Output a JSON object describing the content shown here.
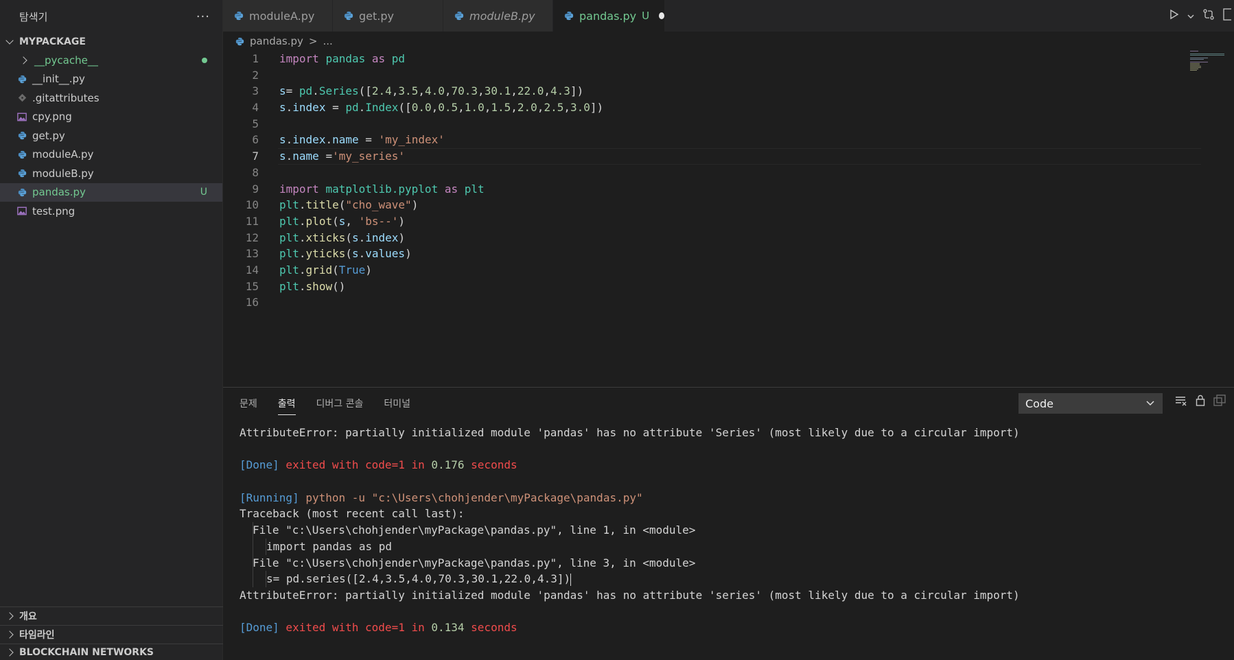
{
  "colors": {
    "keyword": "#c586c0",
    "module": "#4ec9b0",
    "function": "#dcdcaa",
    "variable": "#9cdcfe",
    "number": "#b5cea8",
    "string": "#ce9178",
    "boolean": "#569cd6",
    "text": "#d4d4d4",
    "git_untracked": "#73c991"
  },
  "sidebar": {
    "title": "탐색기",
    "more": "···",
    "section": "MYPACKAGE",
    "items": [
      {
        "label": "__pycache__",
        "type": "folder",
        "icon": "chevron-right-icon"
      },
      {
        "label": "__init__.py",
        "type": "python",
        "icon": "python-icon"
      },
      {
        "label": ".gitattributes",
        "type": "git",
        "icon": "git-icon"
      },
      {
        "label": "cpy.png",
        "type": "image",
        "icon": "image-icon"
      },
      {
        "label": "get.py",
        "type": "python",
        "icon": "python-icon"
      },
      {
        "label": "moduleA.py",
        "type": "python",
        "icon": "python-icon"
      },
      {
        "label": "moduleB.py",
        "type": "python",
        "icon": "python-icon"
      },
      {
        "label": "pandas.py",
        "type": "python",
        "icon": "python-icon",
        "badge": "U"
      },
      {
        "label": "test.png",
        "type": "image",
        "icon": "image-icon"
      }
    ],
    "bottom_sections": [
      "개요",
      "타임라인",
      "BLOCKCHAIN NETWORKS"
    ]
  },
  "tabs": [
    {
      "label": "moduleA.py"
    },
    {
      "label": "get.py"
    },
    {
      "label": "moduleB.py"
    },
    {
      "label": "pandas.py",
      "badge": "U"
    }
  ],
  "breadcrumb": {
    "file": "pandas.py",
    "sep": ">",
    "rest": "..."
  },
  "code": {
    "lines": [
      [
        {
          "t": "import",
          "c": "keyword"
        },
        {
          "t": " "
        },
        {
          "t": "pandas",
          "c": "module"
        },
        {
          "t": " "
        },
        {
          "t": "as",
          "c": "keyword"
        },
        {
          "t": " "
        },
        {
          "t": "pd",
          "c": "module"
        }
      ],
      [],
      [
        {
          "t": "s",
          "c": "variable"
        },
        {
          "t": "= "
        },
        {
          "t": "pd",
          "c": "module"
        },
        {
          "t": "."
        },
        {
          "t": "Series",
          "c": "module"
        },
        {
          "t": "(["
        },
        {
          "t": "2.4",
          "c": "number"
        },
        {
          "t": ","
        },
        {
          "t": "3.5",
          "c": "number"
        },
        {
          "t": ","
        },
        {
          "t": "4.0",
          "c": "number"
        },
        {
          "t": ","
        },
        {
          "t": "70.3",
          "c": "number"
        },
        {
          "t": ","
        },
        {
          "t": "30.1",
          "c": "number"
        },
        {
          "t": ","
        },
        {
          "t": "22.0",
          "c": "number"
        },
        {
          "t": ","
        },
        {
          "t": "4.3",
          "c": "number"
        },
        {
          "t": "])"
        }
      ],
      [
        {
          "t": "s",
          "c": "variable"
        },
        {
          "t": "."
        },
        {
          "t": "index",
          "c": "variable"
        },
        {
          "t": " = "
        },
        {
          "t": "pd",
          "c": "module"
        },
        {
          "t": "."
        },
        {
          "t": "Index",
          "c": "module"
        },
        {
          "t": "(["
        },
        {
          "t": "0.0",
          "c": "number"
        },
        {
          "t": ","
        },
        {
          "t": "0.5",
          "c": "number"
        },
        {
          "t": ","
        },
        {
          "t": "1.0",
          "c": "number"
        },
        {
          "t": ","
        },
        {
          "t": "1.5",
          "c": "number"
        },
        {
          "t": ","
        },
        {
          "t": "2.0",
          "c": "number"
        },
        {
          "t": ","
        },
        {
          "t": "2.5",
          "c": "number"
        },
        {
          "t": ","
        },
        {
          "t": "3.0",
          "c": "number"
        },
        {
          "t": "])"
        }
      ],
      [],
      [
        {
          "t": "s",
          "c": "variable"
        },
        {
          "t": "."
        },
        {
          "t": "index",
          "c": "variable"
        },
        {
          "t": "."
        },
        {
          "t": "name",
          "c": "variable"
        },
        {
          "t": " = "
        },
        {
          "t": "'my_index'",
          "c": "string"
        }
      ],
      [
        {
          "t": "s",
          "c": "variable"
        },
        {
          "t": "."
        },
        {
          "t": "name",
          "c": "variable"
        },
        {
          "t": " ="
        },
        {
          "t": "'my_series'",
          "c": "string"
        }
      ],
      [],
      [
        {
          "t": "import",
          "c": "keyword"
        },
        {
          "t": " "
        },
        {
          "t": "matplotlib.pyplot",
          "c": "module"
        },
        {
          "t": " "
        },
        {
          "t": "as",
          "c": "keyword"
        },
        {
          "t": " "
        },
        {
          "t": "plt",
          "c": "module"
        }
      ],
      [
        {
          "t": "plt",
          "c": "module"
        },
        {
          "t": "."
        },
        {
          "t": "title",
          "c": "function"
        },
        {
          "t": "("
        },
        {
          "t": "\"cho_wave\"",
          "c": "string"
        },
        {
          "t": ")"
        }
      ],
      [
        {
          "t": "plt",
          "c": "module"
        },
        {
          "t": "."
        },
        {
          "t": "plot",
          "c": "function"
        },
        {
          "t": "("
        },
        {
          "t": "s",
          "c": "variable"
        },
        {
          "t": ", "
        },
        {
          "t": "'bs--'",
          "c": "string"
        },
        {
          "t": ")"
        }
      ],
      [
        {
          "t": "plt",
          "c": "module"
        },
        {
          "t": "."
        },
        {
          "t": "xticks",
          "c": "function"
        },
        {
          "t": "("
        },
        {
          "t": "s",
          "c": "variable"
        },
        {
          "t": "."
        },
        {
          "t": "index",
          "c": "variable"
        },
        {
          "t": ")"
        }
      ],
      [
        {
          "t": "plt",
          "c": "module"
        },
        {
          "t": "."
        },
        {
          "t": "yticks",
          "c": "function"
        },
        {
          "t": "("
        },
        {
          "t": "s",
          "c": "variable"
        },
        {
          "t": "."
        },
        {
          "t": "values",
          "c": "variable"
        },
        {
          "t": ")"
        }
      ],
      [
        {
          "t": "plt",
          "c": "module"
        },
        {
          "t": "."
        },
        {
          "t": "grid",
          "c": "function"
        },
        {
          "t": "("
        },
        {
          "t": "True",
          "c": "boolean"
        },
        {
          "t": ")"
        }
      ],
      [
        {
          "t": "plt",
          "c": "module"
        },
        {
          "t": "."
        },
        {
          "t": "show",
          "c": "function"
        },
        {
          "t": "()"
        }
      ],
      []
    ],
    "current_line": 7
  },
  "panel": {
    "tabs": [
      "문제",
      "출력",
      "디버그 콘솔",
      "터미널"
    ],
    "active_tab": 1,
    "select_value": "Code",
    "output": {
      "err1": "AttributeError: partially initialized module 'pandas' has no attribute 'Series' (most likely due to a circular import)",
      "done1": {
        "tag": "[Done]",
        "a": " exited with ",
        "code": "code=1",
        "b": " in ",
        "secs": "0.176",
        "c": " seconds"
      },
      "running": {
        "tag": "[Running]",
        "cmd": " python -u \"c:\\Users\\chohjender\\myPackage\\pandas.py\""
      },
      "traceback": "Traceback (most recent call last):",
      "file1": "File \"c:\\Users\\chohjender\\myPackage\\pandas.py\", line 1, in <module>",
      "src1": "import pandas as pd",
      "file2": "File \"c:\\Users\\chohjender\\myPackage\\pandas.py\", line 3, in <module>",
      "src2": "s= pd.series([2.4,3.5,4.0,70.3,30.1,22.0,4.3])",
      "err2": "AttributeError: partially initialized module 'pandas' has no attribute 'series' (most likely due to a circular import)",
      "done2": {
        "tag": "[Done]",
        "a": " exited with ",
        "code": "code=1",
        "b": " in ",
        "secs": "0.134",
        "c": " seconds"
      }
    }
  }
}
